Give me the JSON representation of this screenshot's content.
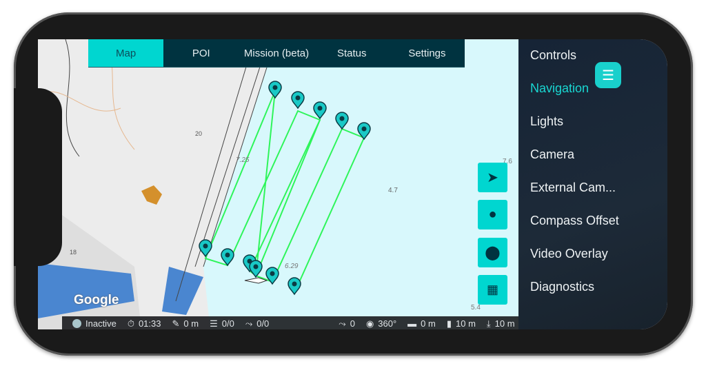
{
  "tabs": [
    {
      "label": "Map",
      "active": true
    },
    {
      "label": "POI"
    },
    {
      "label": "Mission (beta)"
    },
    {
      "label": "Status"
    },
    {
      "label": "Settings"
    }
  ],
  "menu": {
    "items": [
      "Controls",
      "Navigation",
      "Lights",
      "Camera",
      "External Cam...",
      "Compass Offset",
      "Video Overlay",
      "Diagnostics"
    ],
    "active": "Navigation",
    "icon": "hamburger-icon"
  },
  "map_buttons": [
    "navigation-arrow-icon",
    "diver-helmet-icon",
    "location-pin-icon",
    "map-marker-icon"
  ],
  "map_labels": {
    "depth1": "4.7",
    "depth2": "6.29",
    "depth3": "7.25",
    "depth4": "5.4",
    "depth5": "7.6",
    "building1": "20",
    "building2": "18",
    "logo": "Google"
  },
  "status": {
    "state": "Inactive",
    "timer": "01:33",
    "distance": "0 m",
    "waypoints": "0/0",
    "route": "0/0",
    "route2": "0",
    "heading": "360°",
    "range": "0 m",
    "depth": "10 m",
    "altitude": "10 m"
  },
  "colors": {
    "accent": "#00d6d0",
    "tabbar": "#003340",
    "path": "#2ef55a",
    "water": "#d8f8fc"
  }
}
